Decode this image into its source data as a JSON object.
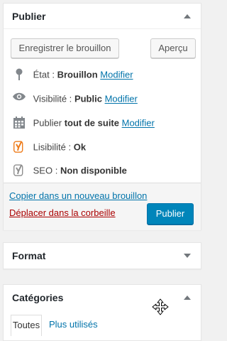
{
  "publish_box": {
    "title": "Publier",
    "save_draft_label": "Enregistrer le brouillon",
    "preview_label": "Aperçu",
    "status": {
      "label": "État :",
      "value": "Brouillon",
      "action": "Modifier"
    },
    "visibility": {
      "label": "Visibilité :",
      "value": "Public",
      "action": "Modifier"
    },
    "schedule": {
      "label": "Publier",
      "value": "tout de suite",
      "action": "Modifier"
    },
    "readability": {
      "label": "Lisibilité :",
      "value": "Ok"
    },
    "seo": {
      "label": "SEO :",
      "value": "Non disponible"
    },
    "copy_link": "Copier dans un nouveau brouillon",
    "trash_link": "Déplacer dans la corbeille",
    "publish_label": "Publier"
  },
  "format_box": {
    "title": "Format"
  },
  "categories_box": {
    "title": "Catégories",
    "tabs": [
      "Toutes",
      "Plus utilisés"
    ]
  },
  "colors": {
    "link": "#0073aa",
    "delete": "#a00000",
    "primary_button": "#0085ba",
    "yoast_orange": "#ee7c1b"
  },
  "icons": [
    "pin-icon",
    "eye-icon",
    "calendar-icon",
    "yoast-readability-icon",
    "yoast-seo-icon",
    "triangle-up-icon",
    "triangle-down-icon",
    "move-cursor-icon"
  ]
}
